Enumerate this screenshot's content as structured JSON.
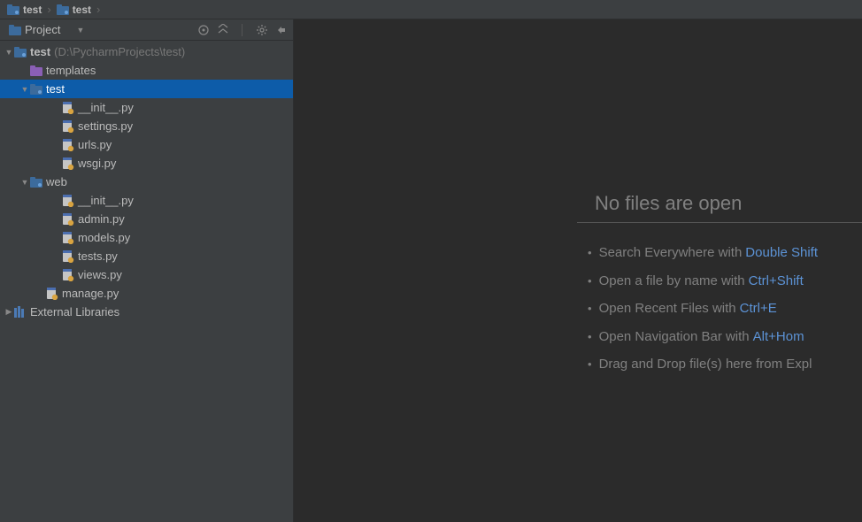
{
  "breadcrumb": [
    {
      "label": "test",
      "type": "module"
    },
    {
      "label": "test",
      "type": "module"
    }
  ],
  "sidebar": {
    "viewLabel": "Project"
  },
  "tree": [
    {
      "id": "root",
      "label": "test",
      "hint": "(D:\\PycharmProjects\\test)",
      "icon": "module",
      "indent": 0,
      "arrow": "down",
      "bold": true
    },
    {
      "id": "templates",
      "label": "templates",
      "icon": "templates-folder",
      "indent": 1,
      "arrow": "none"
    },
    {
      "id": "test-pkg",
      "label": "test",
      "icon": "module",
      "indent": 1,
      "arrow": "down",
      "selected": true
    },
    {
      "id": "init1",
      "label": "__init__.py",
      "icon": "py",
      "indent": 3,
      "arrow": "none"
    },
    {
      "id": "settings",
      "label": "settings.py",
      "icon": "py",
      "indent": 3,
      "arrow": "none"
    },
    {
      "id": "urls",
      "label": "urls.py",
      "icon": "py",
      "indent": 3,
      "arrow": "none"
    },
    {
      "id": "wsgi",
      "label": "wsgi.py",
      "icon": "py",
      "indent": 3,
      "arrow": "none"
    },
    {
      "id": "web",
      "label": "web",
      "icon": "module",
      "indent": 1,
      "arrow": "down"
    },
    {
      "id": "init2",
      "label": "__init__.py",
      "icon": "py",
      "indent": 3,
      "arrow": "none"
    },
    {
      "id": "admin",
      "label": "admin.py",
      "icon": "py",
      "indent": 3,
      "arrow": "none"
    },
    {
      "id": "models",
      "label": "models.py",
      "icon": "py",
      "indent": 3,
      "arrow": "none"
    },
    {
      "id": "tests",
      "label": "tests.py",
      "icon": "py",
      "indent": 3,
      "arrow": "none"
    },
    {
      "id": "views",
      "label": "views.py",
      "icon": "py",
      "indent": 3,
      "arrow": "none"
    },
    {
      "id": "manage",
      "label": "manage.py",
      "icon": "py",
      "indent": 2,
      "arrow": "none"
    },
    {
      "id": "extlib",
      "label": "External Libraries",
      "icon": "lib",
      "indent": 0,
      "arrow": "right"
    }
  ],
  "editor": {
    "emptyTitle": "No files are open",
    "tips": [
      {
        "text": "Search Everywhere with",
        "shortcut": "Double Shift"
      },
      {
        "text": "Open a file by name with",
        "shortcut": "Ctrl+Shift"
      },
      {
        "text": "Open Recent Files with",
        "shortcut": "Ctrl+E"
      },
      {
        "text": "Open Navigation Bar with",
        "shortcut": "Alt+Hom"
      },
      {
        "text": "Drag and Drop file(s) here from Expl",
        "shortcut": ""
      }
    ]
  }
}
